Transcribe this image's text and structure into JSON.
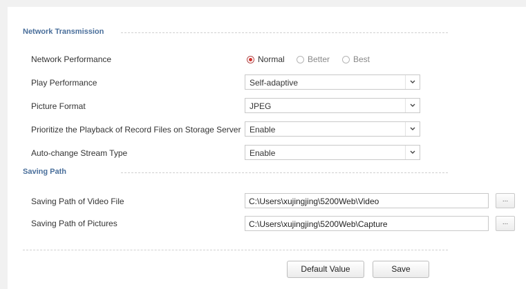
{
  "network_transmission": {
    "title": "Network Transmission",
    "network_performance": {
      "label": "Network Performance",
      "options": [
        "Normal",
        "Better",
        "Best"
      ],
      "selected": "Normal"
    },
    "play_performance": {
      "label": "Play Performance",
      "value": "Self-adaptive"
    },
    "picture_format": {
      "label": "Picture Format",
      "value": "JPEG"
    },
    "prioritize_playback": {
      "label": "Prioritize the Playback of Record Files on Storage Server",
      "value": "Enable"
    },
    "auto_change_stream": {
      "label": "Auto-change Stream Type",
      "value": "Enable"
    }
  },
  "saving_path": {
    "title": "Saving Path",
    "video": {
      "label": "Saving Path of Video File",
      "value": "C:\\Users\\xujingjing\\5200Web\\Video",
      "browse": "..."
    },
    "pictures": {
      "label": "Saving Path of Pictures",
      "value": "C:\\Users\\xujingjing\\5200Web\\Capture",
      "browse": "..."
    }
  },
  "actions": {
    "default_value": "Default Value",
    "save": "Save"
  },
  "icons": {
    "dropdown": "chevron-down-icon"
  }
}
